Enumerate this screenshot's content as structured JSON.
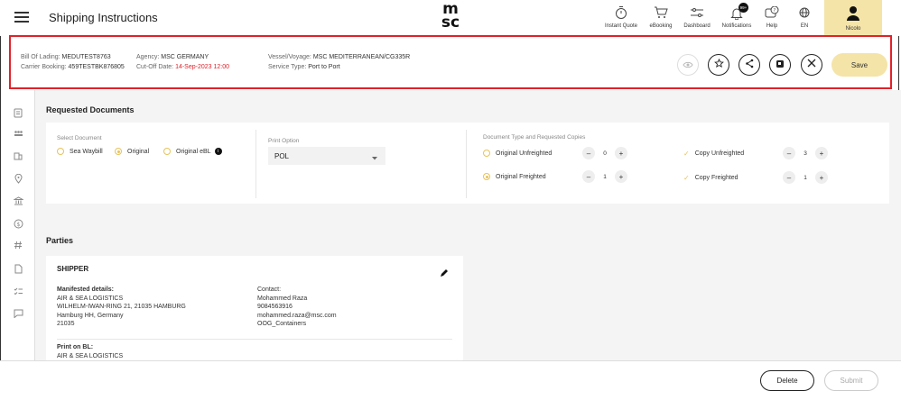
{
  "header": {
    "title": "Shipping Instructions",
    "logo_top": "m",
    "logo_bottom": "sc",
    "nav": [
      {
        "label": "Instant Quote",
        "icon": "stopwatch-icon"
      },
      {
        "label": "eBooking",
        "icon": "cart-icon"
      },
      {
        "label": "Dashboard",
        "icon": "sliders-icon"
      },
      {
        "label": "Notifications",
        "icon": "bell-icon",
        "badge": "99+"
      },
      {
        "label": "Help",
        "icon": "help-icon"
      },
      {
        "label": "EN",
        "icon": "globe-icon"
      }
    ],
    "user": "Nicolo"
  },
  "info": {
    "bol_label": "Bill Of Lading:",
    "bol_value": "MEDUTEST8763",
    "carrier_label": "Carrier Booking:",
    "carrier_value": "459TESTBK876805",
    "agency_label": "Agency:",
    "agency_value": "MSC GERMANY",
    "cutoff_label": "Cut-Off Date:",
    "cutoff_value": "14-Sep-2023 12:00",
    "vessel_label": "Vessel/Voyage:",
    "vessel_value": "MSC MEDITERRANEAN/CG335R",
    "service_label": "Service Type:",
    "service_value": "Port to Port",
    "save_label": "Save",
    "accent": "#f4e4a8",
    "alert": "#e0222a"
  },
  "requested": {
    "heading": "Requested Documents",
    "select_label": "Select Document",
    "options": [
      "Sea Waybill",
      "Original",
      "Original eBL"
    ],
    "selected": "Original",
    "print_label": "Print Option",
    "print_value": "POL",
    "copies_label": "Document Type and Requested Copies",
    "rows": [
      {
        "name": "Original Unfreighted",
        "count": "0"
      },
      {
        "name": "Original Freighted",
        "count": "1"
      },
      {
        "name": "Copy Unfreighted",
        "count": "3"
      },
      {
        "name": "Copy Freighted",
        "count": "1"
      }
    ]
  },
  "parties": {
    "heading": "Parties",
    "shipper_title": "SHIPPER",
    "manifested_label": "Manifested details:",
    "address": [
      "AIR & SEA LOGISTICS",
      "WILHELM-IWAN-RING 21, 21035 HAMBURG",
      "Hamburg HH, Germany",
      "21035"
    ],
    "contact_label": "Contact:",
    "contact": [
      "Mohammed Raza",
      "9084563916",
      "mohammed.raza@msc.com",
      "OOG_Containers"
    ],
    "print_bl_label": "Print on BL:",
    "print_bl_value": "AIR & SEA LOGISTICS"
  },
  "footer": {
    "delete_label": "Delete",
    "submit_label": "Submit"
  }
}
